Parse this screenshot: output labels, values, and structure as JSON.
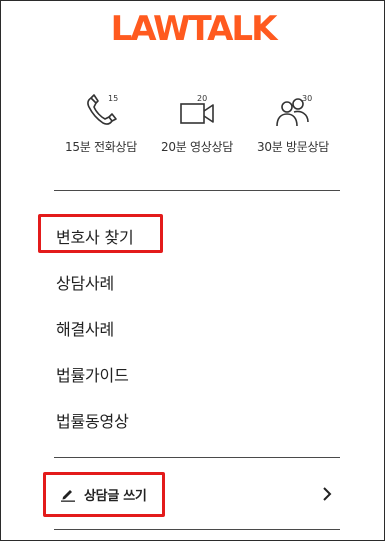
{
  "brand": {
    "logo_text": "LAWTALK",
    "color": "#ff5a1f"
  },
  "quick_actions": [
    {
      "label": "15분 전화상담",
      "icon": "phone-icon",
      "badge": "15"
    },
    {
      "label": "20분 영상상담",
      "icon": "video-camera-icon",
      "badge": "20"
    },
    {
      "label": "30분 방문상담",
      "icon": "people-icon",
      "badge": "30"
    }
  ],
  "menu": {
    "items": [
      {
        "label": "변호사 찾기",
        "highlighted": true
      },
      {
        "label": "상담사례",
        "highlighted": false
      },
      {
        "label": "해결사례",
        "highlighted": false
      },
      {
        "label": "법률가이드",
        "highlighted": false
      },
      {
        "label": "법률동영상",
        "highlighted": false
      }
    ]
  },
  "write": {
    "label": "상담글 쓰기",
    "icon": "pencil-icon",
    "arrow_icon": "chevron-right-icon",
    "highlighted": true
  },
  "colors": {
    "highlight_box": "#e31b1b",
    "divider": "#4a4a4a",
    "text": "#222222"
  }
}
